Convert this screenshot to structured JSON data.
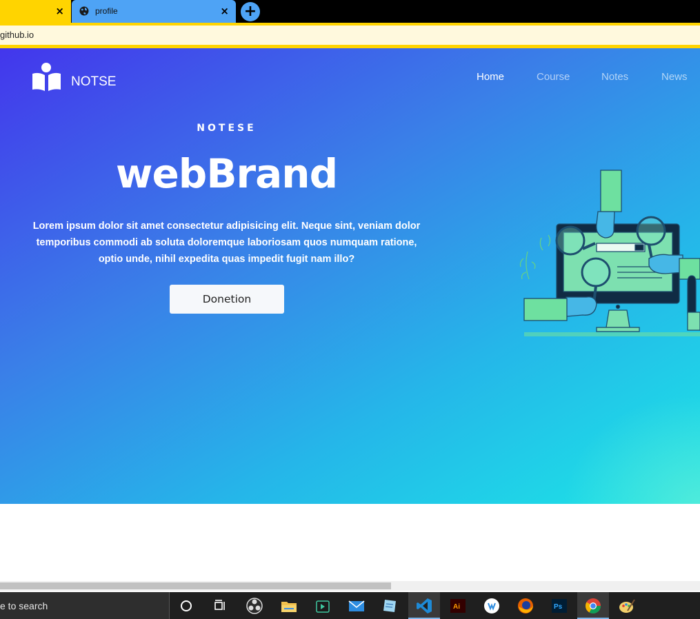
{
  "browser": {
    "tabs": [
      {
        "title": "",
        "active": false,
        "close": "×"
      },
      {
        "title": "profile",
        "active": true,
        "close": "×"
      }
    ],
    "new_tab": "+",
    "address": "github.io"
  },
  "site": {
    "brand": "NOTSE",
    "nav": [
      {
        "label": "Home",
        "active": true
      },
      {
        "label": "Course",
        "active": false
      },
      {
        "label": "Notes",
        "active": false
      },
      {
        "label": "News",
        "active": false
      }
    ],
    "kicker": "NOTESE",
    "title": "webBrand",
    "description": "Lorem ipsum dolor sit amet consectetur adipisicing elit. Neque sint, veniam dolor temporibus commodi ab soluta doloremque laboriosam quos numquam ratione, optio unde, nihil expedita quas impedit fugit nam illo?",
    "cta": "Donetion"
  },
  "colors": {
    "gradient_start": "#4336ec",
    "gradient_mid": "#25b6e9",
    "gradient_end": "#1ce6e6",
    "tab_yellow": "#ffd400",
    "tab_blue": "#4ea3f5"
  },
  "taskbar": {
    "search_text": "e to search",
    "icons": [
      "cortana-icon",
      "task-view-icon",
      "obs-icon",
      "file-explorer-icon",
      "store-icon",
      "mail-icon",
      "notepad-icon",
      "vscode-icon",
      "illustrator-icon",
      "wps-icon",
      "firefox-icon",
      "photoshop-icon",
      "chrome-icon",
      "paint-icon"
    ]
  }
}
